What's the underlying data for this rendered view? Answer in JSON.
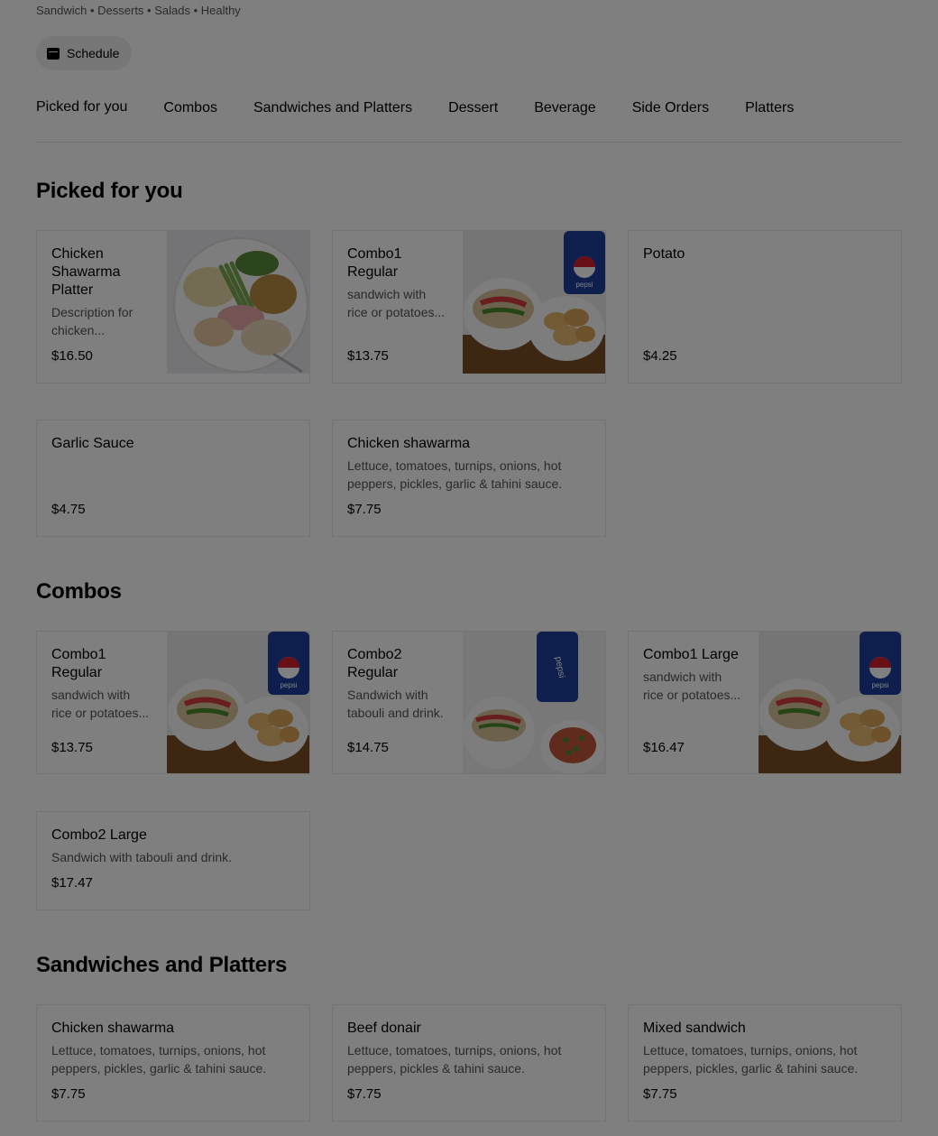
{
  "store": {
    "cuisines": "Sandwich • Desserts • Salads • Healthy",
    "schedule_label": "Schedule"
  },
  "tabs": [
    {
      "label": "Picked for you"
    },
    {
      "label": "Combos"
    },
    {
      "label": "Sandwiches and Platters"
    },
    {
      "label": "Dessert"
    },
    {
      "label": "Beverage"
    },
    {
      "label": "Side Orders"
    },
    {
      "label": "Platters"
    }
  ],
  "sections": {
    "picked": {
      "title": "Picked for you",
      "items": [
        {
          "name": "Chicken Shawarma Platter",
          "description": "Description for chicken...",
          "price": "$16.50",
          "image": "platter-photo"
        },
        {
          "name": "Combo1 Regular",
          "description": "sandwich with rice or potatoes...",
          "price": "$13.75",
          "image": "combo-wrap-potatoes-pepsi-photo"
        },
        {
          "name": "Potato",
          "description": "",
          "price": "$4.25"
        },
        {
          "name": "Garlic Sauce",
          "description": "",
          "price": "$4.75"
        },
        {
          "name": "Chicken shawarma",
          "description": "Lettuce, tomatoes, turnips, onions, hot peppers, pickles, garlic & tahini sauce.",
          "price": "$7.75"
        }
      ]
    },
    "combos": {
      "title": "Combos",
      "items": [
        {
          "name": "Combo1 Regular",
          "description": "sandwich with rice or potatoes...",
          "price": "$13.75",
          "image": "combo-wrap-potatoes-pepsi-photo"
        },
        {
          "name": "Combo2 Regular",
          "description": "Sandwich with tabouli and drink.",
          "price": "$14.75",
          "image": "combo-wrap-tabouli-pepsi-photo"
        },
        {
          "name": "Combo1 Large",
          "description": "sandwich with rice or potatoes...",
          "price": "$16.47",
          "image": "combo-wrap-potatoes-pepsi-photo"
        },
        {
          "name": "Combo2 Large",
          "description": "Sandwich with tabouli and drink.",
          "price": "$17.47"
        }
      ]
    },
    "sandwiches": {
      "title": "Sandwiches and Platters",
      "items": [
        {
          "name": "Chicken shawarma",
          "description": "Lettuce, tomatoes, turnips, onions, hot peppers, pickles, garlic & tahini sauce.",
          "price": "$7.75"
        },
        {
          "name": "Beef donair",
          "description": "Lettuce, tomatoes, turnips, onions, hot peppers, pickles & tahini sauce.",
          "price": "$7.75"
        },
        {
          "name": "Mixed sandwich",
          "description": "Lettuce, tomatoes, turnips, onions, hot peppers, pickles, garlic & tahini sauce.",
          "price": "$7.75"
        }
      ]
    }
  },
  "pepsi_label": "pepsi",
  "colors": {
    "overlay": "#000000",
    "overlay_opacity": "0.5",
    "secondary_text": "#545454",
    "border": "#e8e8e8"
  }
}
